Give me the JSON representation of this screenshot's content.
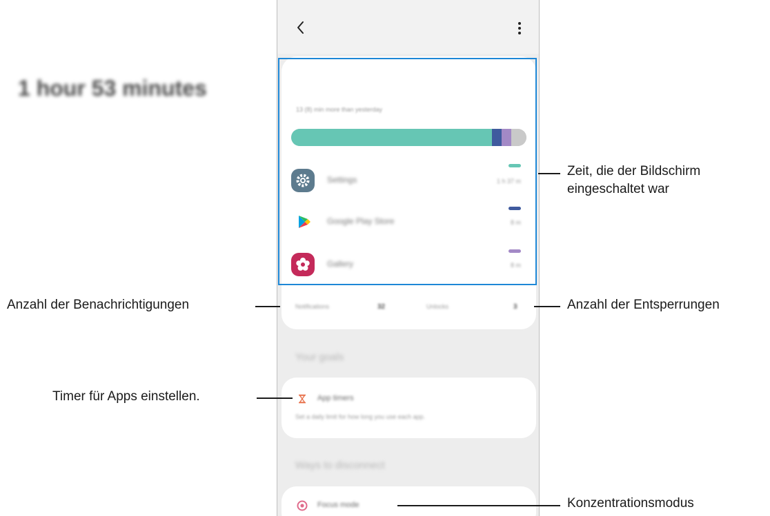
{
  "screen": {
    "total_time": "1 hour 53 minutes",
    "comparison": "13 (8) min more than yesterday",
    "usage_bar": [
      {
        "color": "#66c6b4",
        "fraction": 0.853
      },
      {
        "color": "#3f5a9e",
        "fraction": 0.041
      },
      {
        "color": "#a389c6",
        "fraction": 0.041
      },
      {
        "color": "#c9c9c9",
        "fraction": 0.065
      }
    ],
    "apps": [
      {
        "name": "Settings",
        "time": "1 h 37 m",
        "icon": "gear-icon",
        "icon_color": "#5d7b8e",
        "dot_color": "#66c6b4"
      },
      {
        "name": "Google Play Store",
        "time": "8 m",
        "icon": "play-store-icon",
        "icon_color": "#ffffff",
        "dot_color": "#3f5a9e"
      },
      {
        "name": "Gallery",
        "time": "8 m",
        "icon": "gallery-flower-icon",
        "icon_color": "#c42a5a",
        "dot_color": "#a389c6"
      }
    ],
    "stats": {
      "notifications_label": "Notifications",
      "notifications_value": "32",
      "unlocks_label": "Unlocks",
      "unlocks_value": "3"
    },
    "goals_header": "Your goals",
    "goal": {
      "title": "App timers",
      "description": "Set a daily limit for how long you use each app."
    },
    "disconnect_header": "Ways to disconnect",
    "focus_title": "Focus mode"
  },
  "callouts": {
    "screen_time_line1": "Zeit, die der Bildschirm",
    "screen_time_line2": "eingeschaltet war",
    "notifications": "Anzahl der Benachrichtigungen",
    "unlocks": "Anzahl der Entsperrungen",
    "app_timers": "Timer für Apps einstellen.",
    "focus_mode": "Konzentrationsmodus"
  },
  "colors": {
    "highlight": "#1d87d6",
    "timer_icon": "#e8734d",
    "focus_icon": "#e06b8b"
  }
}
